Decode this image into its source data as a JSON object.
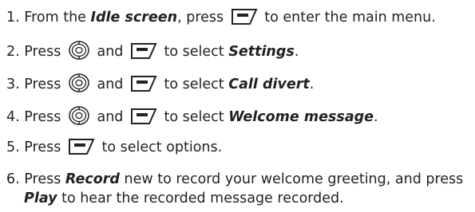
{
  "steps": [
    {
      "num": "1.",
      "t1": "From the ",
      "b1": "Idle screen",
      "t2": ", press ",
      "icon1": "softkey-icon",
      "t3": " to enter the main menu."
    },
    {
      "num": "2.",
      "t1": "Press ",
      "icon1": "navigation-key-icon",
      "t2": " and ",
      "icon2": "softkey-icon",
      "t3": " to select ",
      "b1": "Settings",
      "t4": "."
    },
    {
      "num": "3.",
      "t1": "Press ",
      "icon1": "navigation-key-icon",
      "t2": " and ",
      "icon2": "softkey-icon",
      "t3": " to select ",
      "b1": "Call divert",
      "t4": "."
    },
    {
      "num": "4.",
      "t1": "Press ",
      "icon1": "navigation-key-icon",
      "t2": " and ",
      "icon2": "softkey-icon",
      "t3": " to select ",
      "b1": "Welcome message",
      "t4": "."
    },
    {
      "num": "5.",
      "t1": "Press ",
      "icon1": "softkey-icon",
      "t2": " to select options."
    },
    {
      "num": "6.",
      "t1": "Press ",
      "b1": "Record",
      "t2": " new to record your welcome greeting, and press",
      "b2": "Play",
      "t3": " to hear the recorded message recorded."
    }
  ]
}
